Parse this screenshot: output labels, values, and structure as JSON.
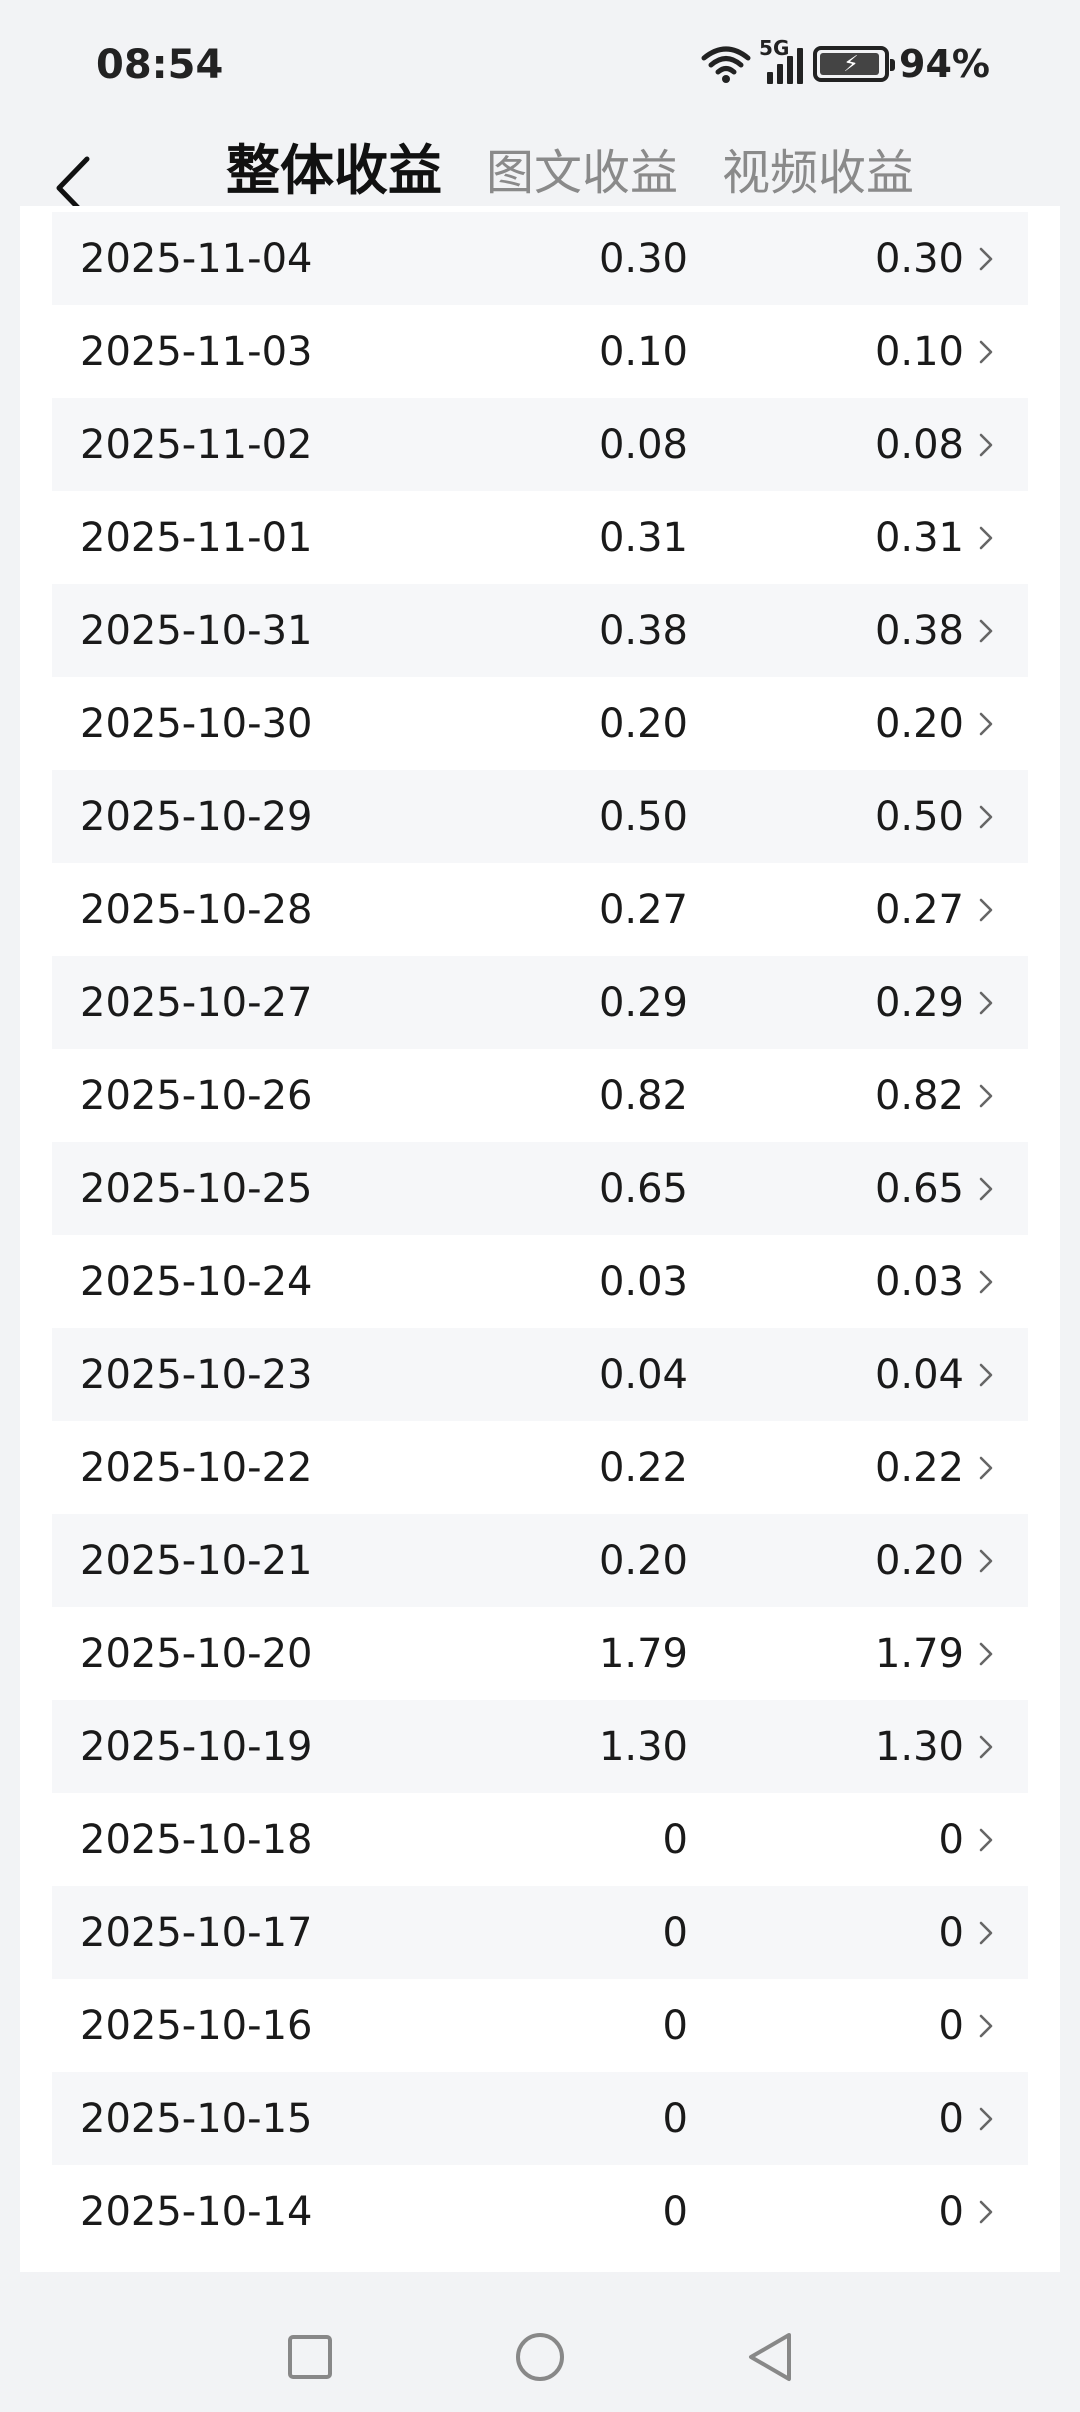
{
  "status_bar": {
    "time": "08:54",
    "network": "5G",
    "battery": "94%"
  },
  "header": {
    "tabs": [
      {
        "label": "整体收益",
        "active": true
      },
      {
        "label": "图文收益",
        "active": false
      },
      {
        "label": "视频收益",
        "active": false
      }
    ]
  },
  "earnings_list": {
    "rows": [
      {
        "date": "2025-11-04",
        "value1": "0.30",
        "value2": "0.30"
      },
      {
        "date": "2025-11-03",
        "value1": "0.10",
        "value2": "0.10"
      },
      {
        "date": "2025-11-02",
        "value1": "0.08",
        "value2": "0.08"
      },
      {
        "date": "2025-11-01",
        "value1": "0.31",
        "value2": "0.31"
      },
      {
        "date": "2025-10-31",
        "value1": "0.38",
        "value2": "0.38"
      },
      {
        "date": "2025-10-30",
        "value1": "0.20",
        "value2": "0.20"
      },
      {
        "date": "2025-10-29",
        "value1": "0.50",
        "value2": "0.50"
      },
      {
        "date": "2025-10-28",
        "value1": "0.27",
        "value2": "0.27"
      },
      {
        "date": "2025-10-27",
        "value1": "0.29",
        "value2": "0.29"
      },
      {
        "date": "2025-10-26",
        "value1": "0.82",
        "value2": "0.82"
      },
      {
        "date": "2025-10-25",
        "value1": "0.65",
        "value2": "0.65"
      },
      {
        "date": "2025-10-24",
        "value1": "0.03",
        "value2": "0.03"
      },
      {
        "date": "2025-10-23",
        "value1": "0.04",
        "value2": "0.04"
      },
      {
        "date": "2025-10-22",
        "value1": "0.22",
        "value2": "0.22"
      },
      {
        "date": "2025-10-21",
        "value1": "0.20",
        "value2": "0.20"
      },
      {
        "date": "2025-10-20",
        "value1": "1.79",
        "value2": "1.79"
      },
      {
        "date": "2025-10-19",
        "value1": "1.30",
        "value2": "1.30"
      },
      {
        "date": "2025-10-18",
        "value1": "0",
        "value2": "0"
      },
      {
        "date": "2025-10-17",
        "value1": "0",
        "value2": "0"
      },
      {
        "date": "2025-10-16",
        "value1": "0",
        "value2": "0"
      },
      {
        "date": "2025-10-15",
        "value1": "0",
        "value2": "0"
      },
      {
        "date": "2025-10-14",
        "value1": "0",
        "value2": "0"
      }
    ]
  },
  "icons": {
    "back": "chevron-left-icon",
    "row_arrow": "chevron-right-icon",
    "nav_recent": "square-icon",
    "nav_home": "circle-icon",
    "nav_back": "triangle-back-icon"
  },
  "colors": {
    "background": "#f2f3f5",
    "card": "#ffffff",
    "row_alt": "#f6f7f9",
    "tab_active": "#111111",
    "tab_inactive": "#8a8a8a"
  }
}
